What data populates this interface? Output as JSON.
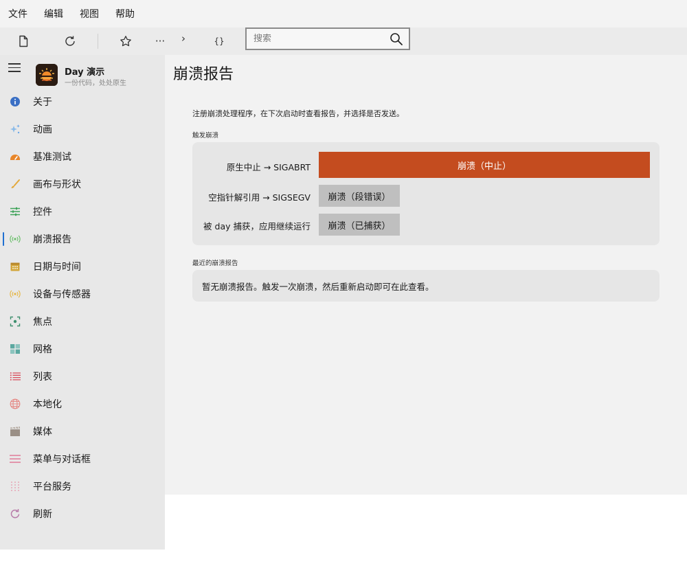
{
  "menubar": {
    "items": [
      "文件",
      "编辑",
      "视图",
      "帮助"
    ]
  },
  "toolbar": {
    "more_label": "···",
    "chevron_label": "›",
    "braces_label": "{}"
  },
  "search": {
    "placeholder": "搜索",
    "value": ""
  },
  "app": {
    "title": "Day 演示",
    "subtitle": "一份代码，处处原生"
  },
  "sidebar": {
    "items": [
      {
        "label": "关于",
        "icon": "info-icon",
        "color": "#3a6fc4"
      },
      {
        "label": "动画",
        "icon": "sparkle-icon",
        "color": "#6aa7e8"
      },
      {
        "label": "基准测试",
        "icon": "speedometer-icon",
        "color": "#e8862a"
      },
      {
        "label": "画布与形状",
        "icon": "brush-icon",
        "color": "#e3a83a"
      },
      {
        "label": "控件",
        "icon": "sliders-icon",
        "color": "#3fa35a"
      },
      {
        "label": "崩溃报告",
        "icon": "broadcast-icon",
        "color": "#6bbf6b",
        "active": true
      },
      {
        "label": "日期与时间",
        "icon": "calendar-icon",
        "color": "#d3a63a"
      },
      {
        "label": "设备与传感器",
        "icon": "sensor-icon",
        "color": "#e6b84a"
      },
      {
        "label": "焦点",
        "icon": "focus-icon",
        "color": "#3e8f6e"
      },
      {
        "label": "网格",
        "icon": "grid-icon",
        "color": "#5ba8a0"
      },
      {
        "label": "列表",
        "icon": "list-icon",
        "color": "#d94b5a"
      },
      {
        "label": "本地化",
        "icon": "globe-icon",
        "color": "#e58a86"
      },
      {
        "label": "媒体",
        "icon": "clapperboard-icon",
        "color": "#9a8f86"
      },
      {
        "label": "菜单与对话框",
        "icon": "menu-lines-icon",
        "color": "#e07a98"
      },
      {
        "label": "平台服务",
        "icon": "dots-grid-icon",
        "color": "#e7a6b6"
      },
      {
        "label": "刷新",
        "icon": "refresh-icon",
        "color": "#b77aa8"
      }
    ]
  },
  "main": {
    "title": "崩溃报告",
    "intro": "注册崩溃处理程序，在下次启动时查看报告，并选择是否发送。",
    "trigger_section": "触发崩溃",
    "rows": [
      {
        "label": "原生中止 → SIGABRT",
        "button": "崩溃（中止）"
      },
      {
        "label": "空指针解引用 → SIGSEGV",
        "button": "崩溃（段错误）"
      },
      {
        "label": "被 day 捕获，应用继续运行",
        "button": "崩溃（已捕获）"
      }
    ],
    "recent_section": "最近的崩溃报告",
    "empty_text": "暂无崩溃报告。触发一次崩溃，然后重新启动即可在此查看。"
  },
  "colors": {
    "accent": "#c44c1f",
    "active_indicator": "#1f6fd1"
  }
}
